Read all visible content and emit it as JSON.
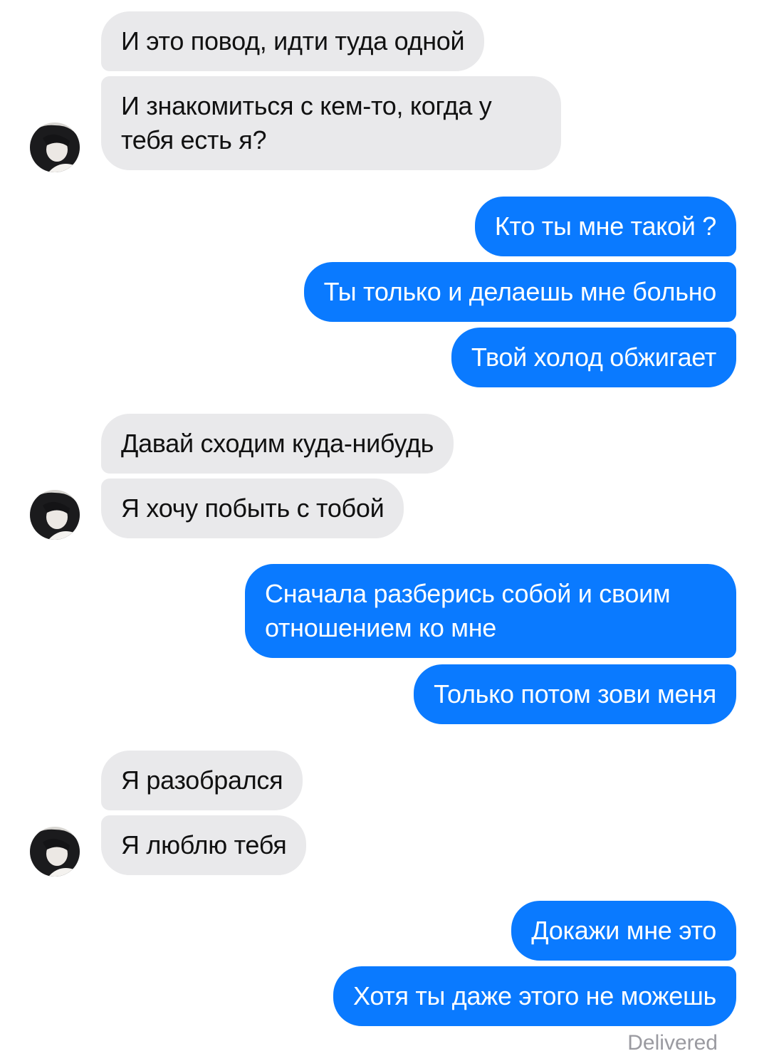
{
  "messages": [
    {
      "text": "И это повод, идти туда одной"
    },
    {
      "text": "И знакомиться с кем-то, когда у тебя есть я?"
    },
    {
      "text": "Кто ты мне такой ?"
    },
    {
      "text": "Ты только и делаешь мне больно"
    },
    {
      "text": "Твой холод обжигает"
    },
    {
      "text": "Давай сходим куда-нибудь"
    },
    {
      "text": "Я хочу побыть с тобой"
    },
    {
      "text": "Сначала разберись собой и своим отношением ко мне"
    },
    {
      "text": "Только потом зови меня"
    },
    {
      "text": "Я разобрался"
    },
    {
      "text": "Я люблю тебя"
    },
    {
      "text": "Докажи мне это"
    },
    {
      "text": "Хотя ты даже этого не можешь"
    }
  ],
  "status": "Delivered",
  "colors": {
    "outgoing_bubble": "#0a7aff",
    "incoming_bubble": "#e9e9eb",
    "status_text": "#9a9aa0"
  },
  "icons": {
    "avatar": "contact-avatar-photo"
  }
}
